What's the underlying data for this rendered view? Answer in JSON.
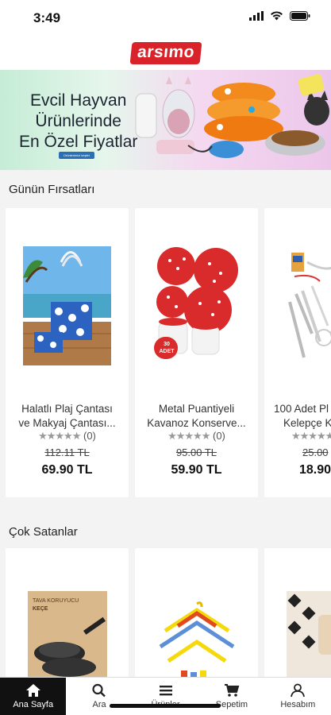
{
  "status": {
    "time": "3:49"
  },
  "header": {
    "logo_text": "arsımo"
  },
  "banner": {
    "lines": [
      "Evcil Hayvan",
      "Ürünlerinde",
      "En Özel Fiyatlar"
    ],
    "badge": "Ürünlerimizi keşfet"
  },
  "sections": {
    "deals_title": "Günün Fırsatları",
    "bestsellers_title": "Çok Satanlar"
  },
  "deals": [
    {
      "name_line1": "Halatlı Plaj Çantası",
      "name_line2": "ve Makyaj Çantası...",
      "stars": "★★★★★",
      "reviews": "(0)",
      "old_price": "112.11 TL",
      "price": "69.90 TL"
    },
    {
      "name_line1": "Metal Puantiyeli",
      "name_line2": "Kavanoz Konserve...",
      "stars": "★★★★★",
      "reviews": "(0)",
      "old_price": "95.00 TL",
      "price": "59.90 TL"
    },
    {
      "name_line1": "100 Adet Pl",
      "name_line2": "Kelepçe Ka",
      "stars": "★★★★★",
      "reviews": "",
      "old_price": "25.00",
      "price": "18.90"
    }
  ],
  "bestsellers": [
    {
      "image_text_line1": "TAVA KORUYUCU",
      "image_text_line2": "KEÇE"
    }
  ],
  "deal2_badge": {
    "line1": "30",
    "line2": "ADET"
  },
  "tabbar": [
    {
      "label": "Ana Sayfa",
      "icon": "home-icon",
      "active": true
    },
    {
      "label": "Ara",
      "icon": "search-icon",
      "active": false
    },
    {
      "label": "Ürünler",
      "icon": "menu-icon",
      "active": false
    },
    {
      "label": "Sepetim",
      "icon": "cart-icon",
      "active": false
    },
    {
      "label": "Hesabım",
      "icon": "user-icon",
      "active": false
    }
  ],
  "colors": {
    "brand": "#d8232a",
    "tab_active_bg": "#111111"
  }
}
